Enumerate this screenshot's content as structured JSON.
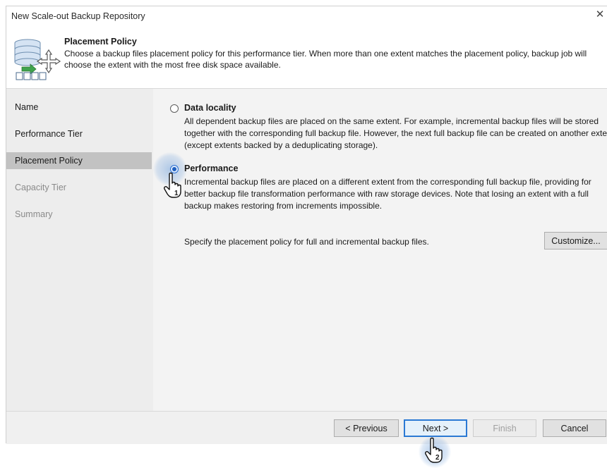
{
  "window": {
    "title": "New Scale-out Backup Repository",
    "close_glyph": "✕"
  },
  "header": {
    "title": "Placement Policy",
    "description": "Choose a backup files placement policy for this performance tier. When more than one extent matches the placement policy, backup job will choose the extent with the most free disk space available.",
    "icon": "repository-move-icon"
  },
  "sidebar": {
    "items": [
      {
        "label": "Name",
        "state": "normal"
      },
      {
        "label": "Performance Tier",
        "state": "normal"
      },
      {
        "label": "Placement Policy",
        "state": "active"
      },
      {
        "label": "Capacity Tier",
        "state": "disabled"
      },
      {
        "label": "Summary",
        "state": "disabled"
      }
    ]
  },
  "options": [
    {
      "label": "Data locality",
      "checked": false,
      "description": "All dependent backup files are placed on the same extent. For example, incremental backup files will be stored together with the corresponding full backup file. However, the next full backup file can be created on another extent (except extents backed by a deduplicating storage)."
    },
    {
      "label": "Performance",
      "checked": true,
      "description": "Incremental backup files are placed on a different extent from the corresponding full backup file, providing for better backup file transformation performance with raw storage devices. Note that losing an extent with a full backup makes restoring from increments impossible."
    }
  ],
  "specify": {
    "text": "Specify the placement policy for full and incremental backup files.",
    "customize_label": "Customize..."
  },
  "footer": {
    "previous_label": "< Previous",
    "next_label": "Next >",
    "finish_label": "Finish",
    "cancel_label": "Cancel"
  },
  "annotations": {
    "step1": "1",
    "step2": "2"
  },
  "colors": {
    "accent": "#2b79d4",
    "sidebar_bg": "#ededed",
    "sidebar_active": "#c2c2c2",
    "content_bg": "#f3f3f3"
  }
}
